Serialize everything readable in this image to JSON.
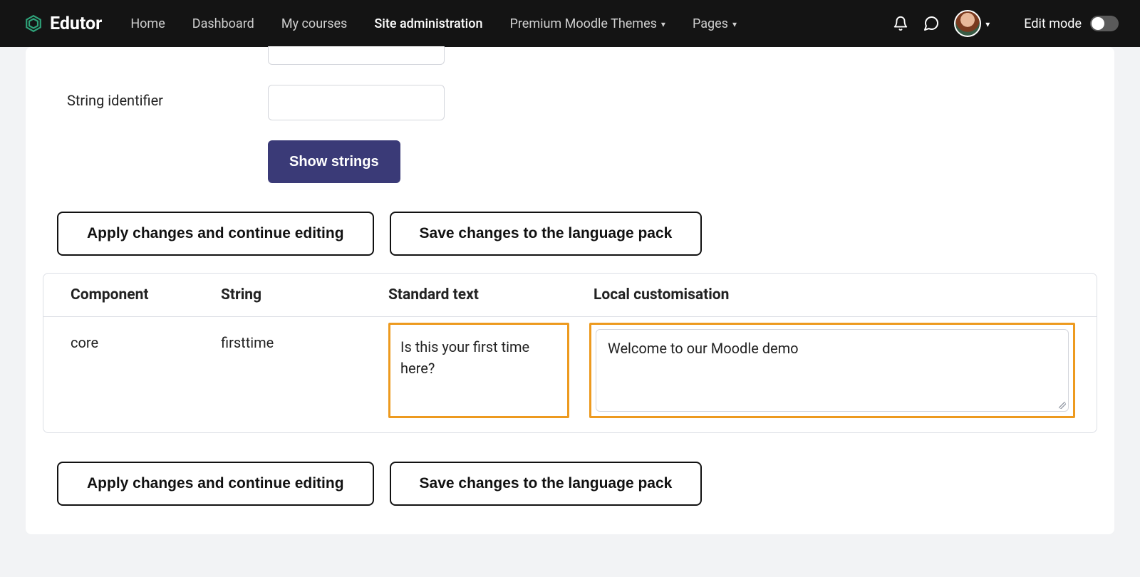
{
  "brand": {
    "name": "Edutor"
  },
  "nav": {
    "items": [
      {
        "label": "Home"
      },
      {
        "label": "Dashboard"
      },
      {
        "label": "My courses"
      },
      {
        "label": "Site administration",
        "active": true
      },
      {
        "label": "Premium Moodle Themes",
        "dropdown": true
      },
      {
        "label": "Pages",
        "dropdown": true
      }
    ],
    "editmode_label": "Edit mode"
  },
  "form": {
    "prev_field_value": "",
    "string_identifier_label": "String identifier",
    "string_identifier_value": "",
    "show_strings_label": "Show strings"
  },
  "actions": {
    "apply_label": "Apply changes and continue editing",
    "save_label": "Save changes to the language pack"
  },
  "table": {
    "headers": {
      "component": "Component",
      "string": "String",
      "standard": "Standard text",
      "local": "Local customisation"
    },
    "rows": [
      {
        "component": "core",
        "string": "firsttime",
        "standard": "Is this your first time here?",
        "local": "Welcome to our Moodle demo"
      }
    ]
  }
}
